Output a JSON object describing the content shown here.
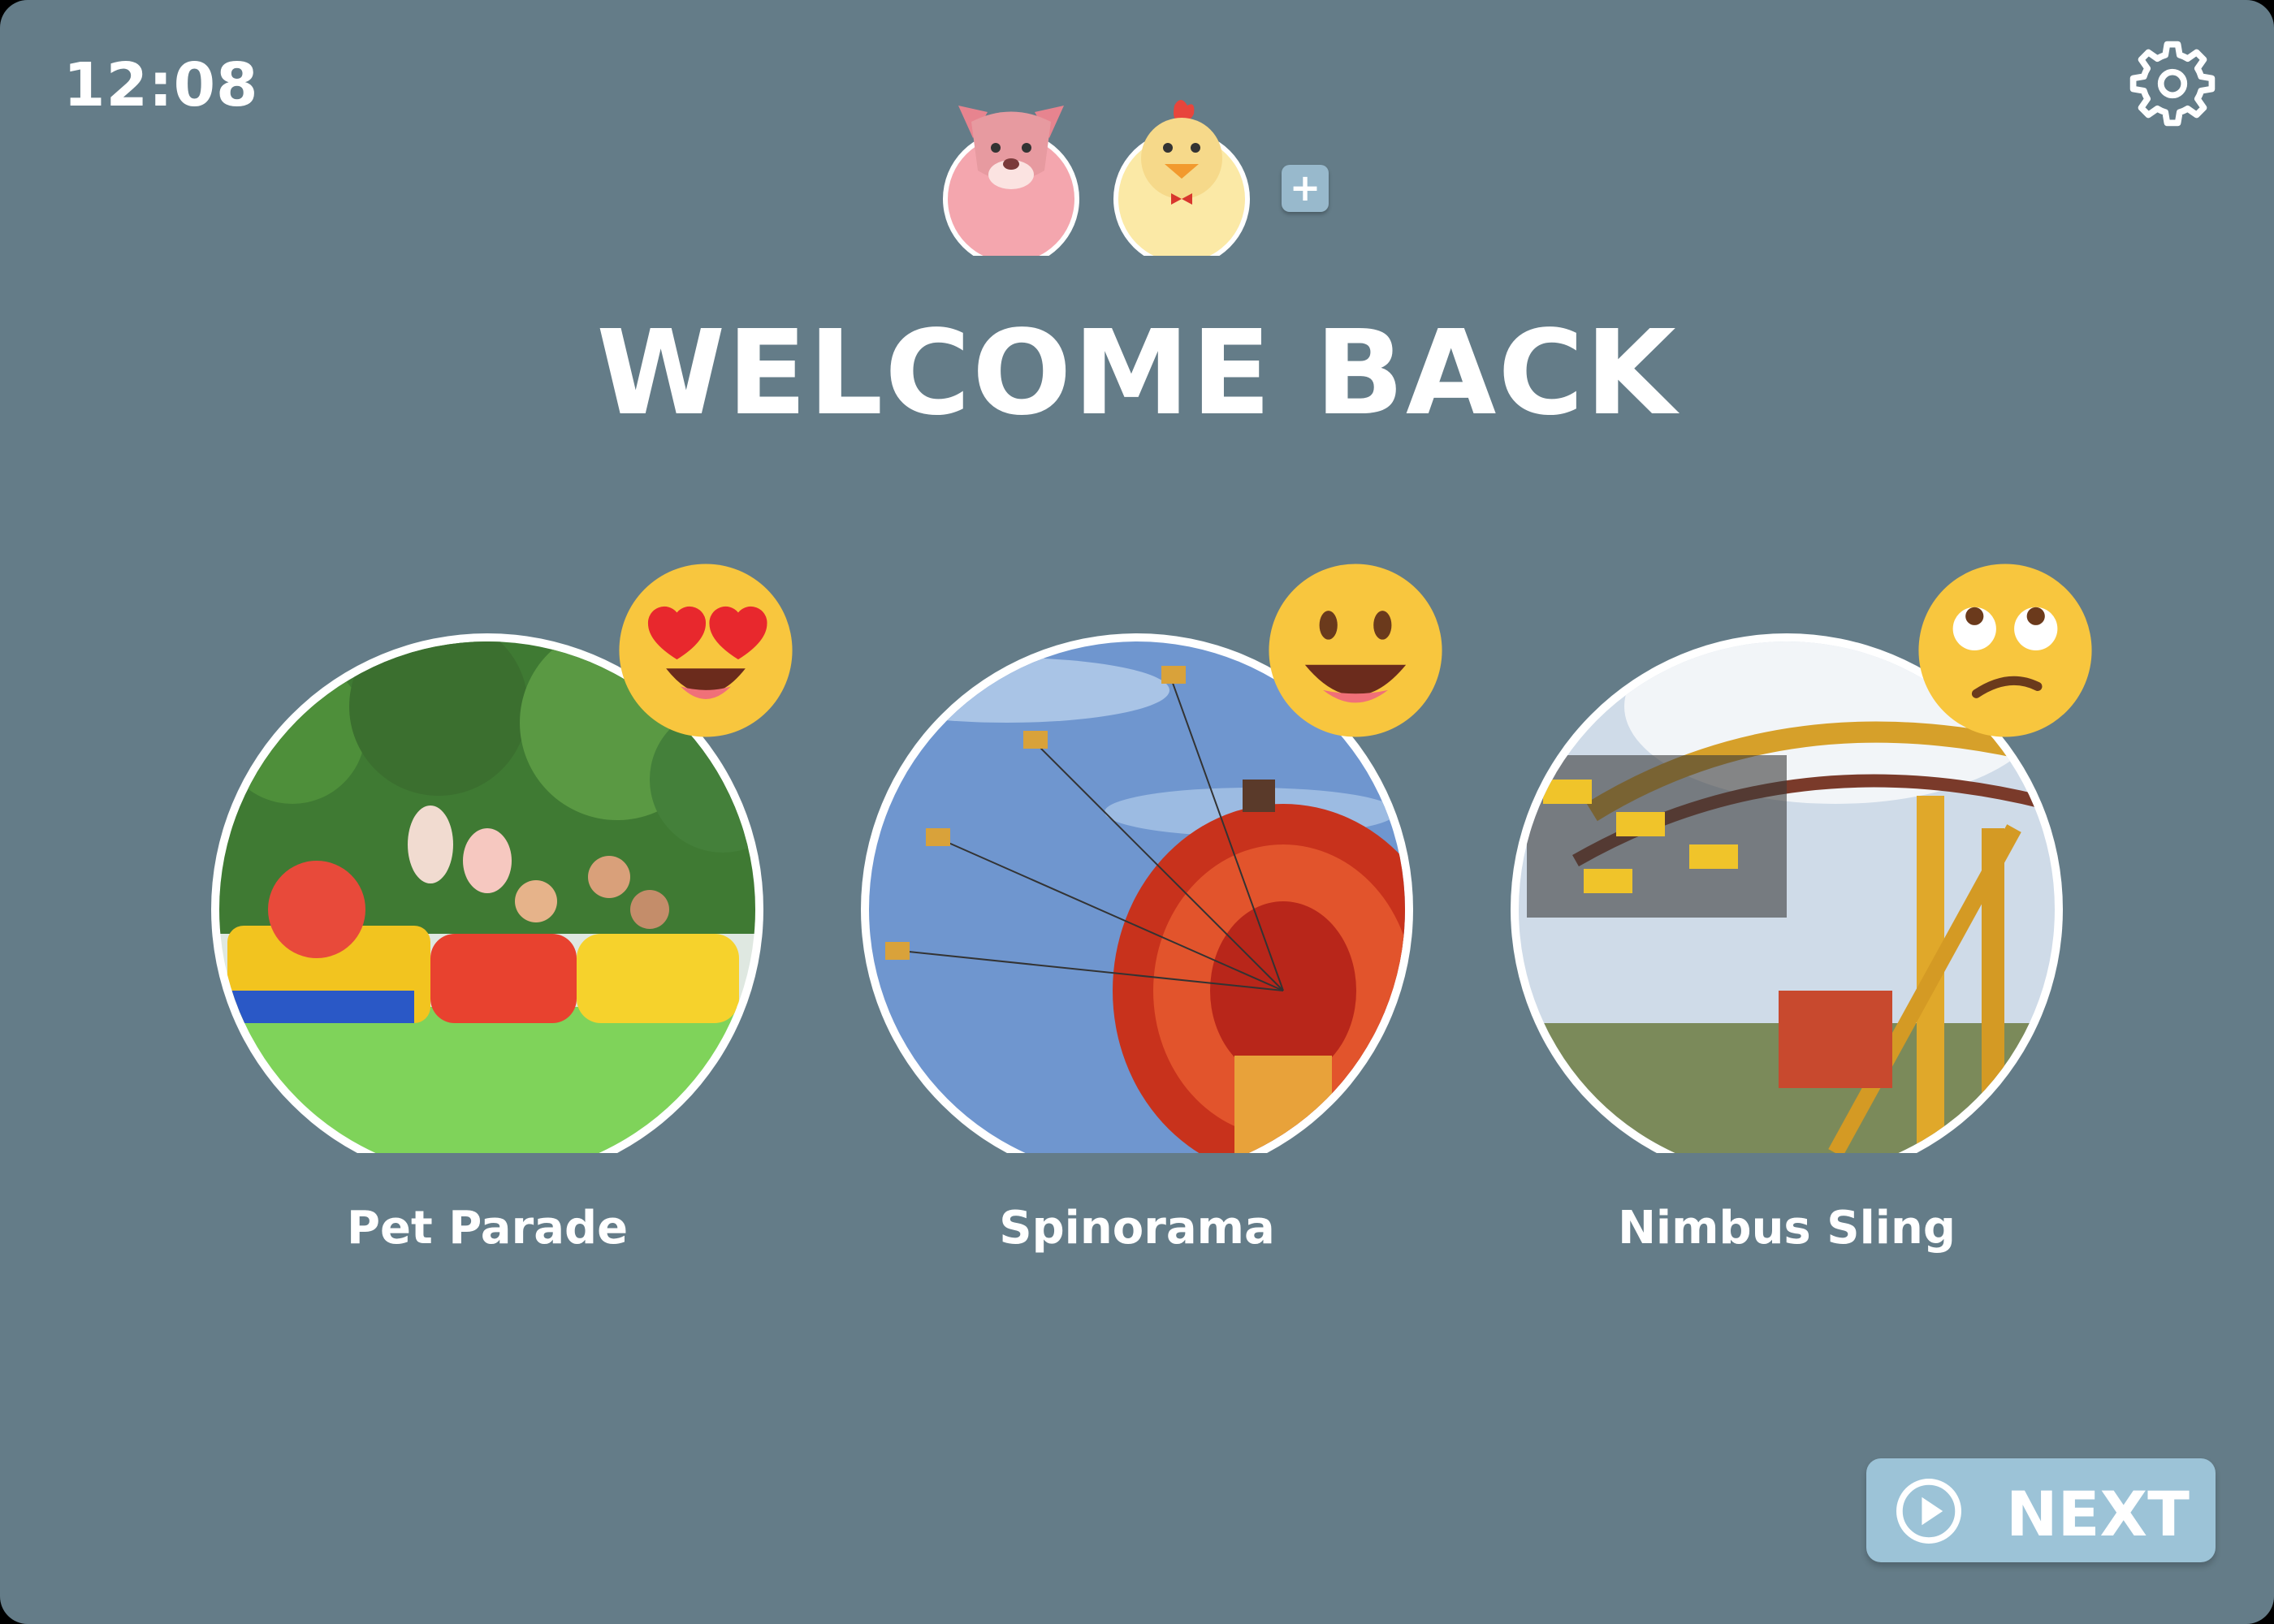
{
  "clock": "12:08",
  "header": {
    "title": "WELCOME BACK",
    "avatars": [
      {
        "icon": "dog-avatar-icon",
        "color": "#f4a6ae"
      },
      {
        "icon": "chick-avatar-icon",
        "color": "#fbe9a6"
      }
    ],
    "add_profile_label": "+"
  },
  "rides": [
    {
      "name": "Pet Parade",
      "reaction": "heart-eyes-emoji"
    },
    {
      "name": "Spinorama",
      "reaction": "grinning-emoji"
    },
    {
      "name": "Nimbus Sling",
      "reaction": "eye-roll-emoji"
    }
  ],
  "next_button": {
    "label": "NEXT"
  },
  "colors": {
    "background": "#647c88",
    "button": "#9cc3d7",
    "emoji": "#f8c63e"
  }
}
